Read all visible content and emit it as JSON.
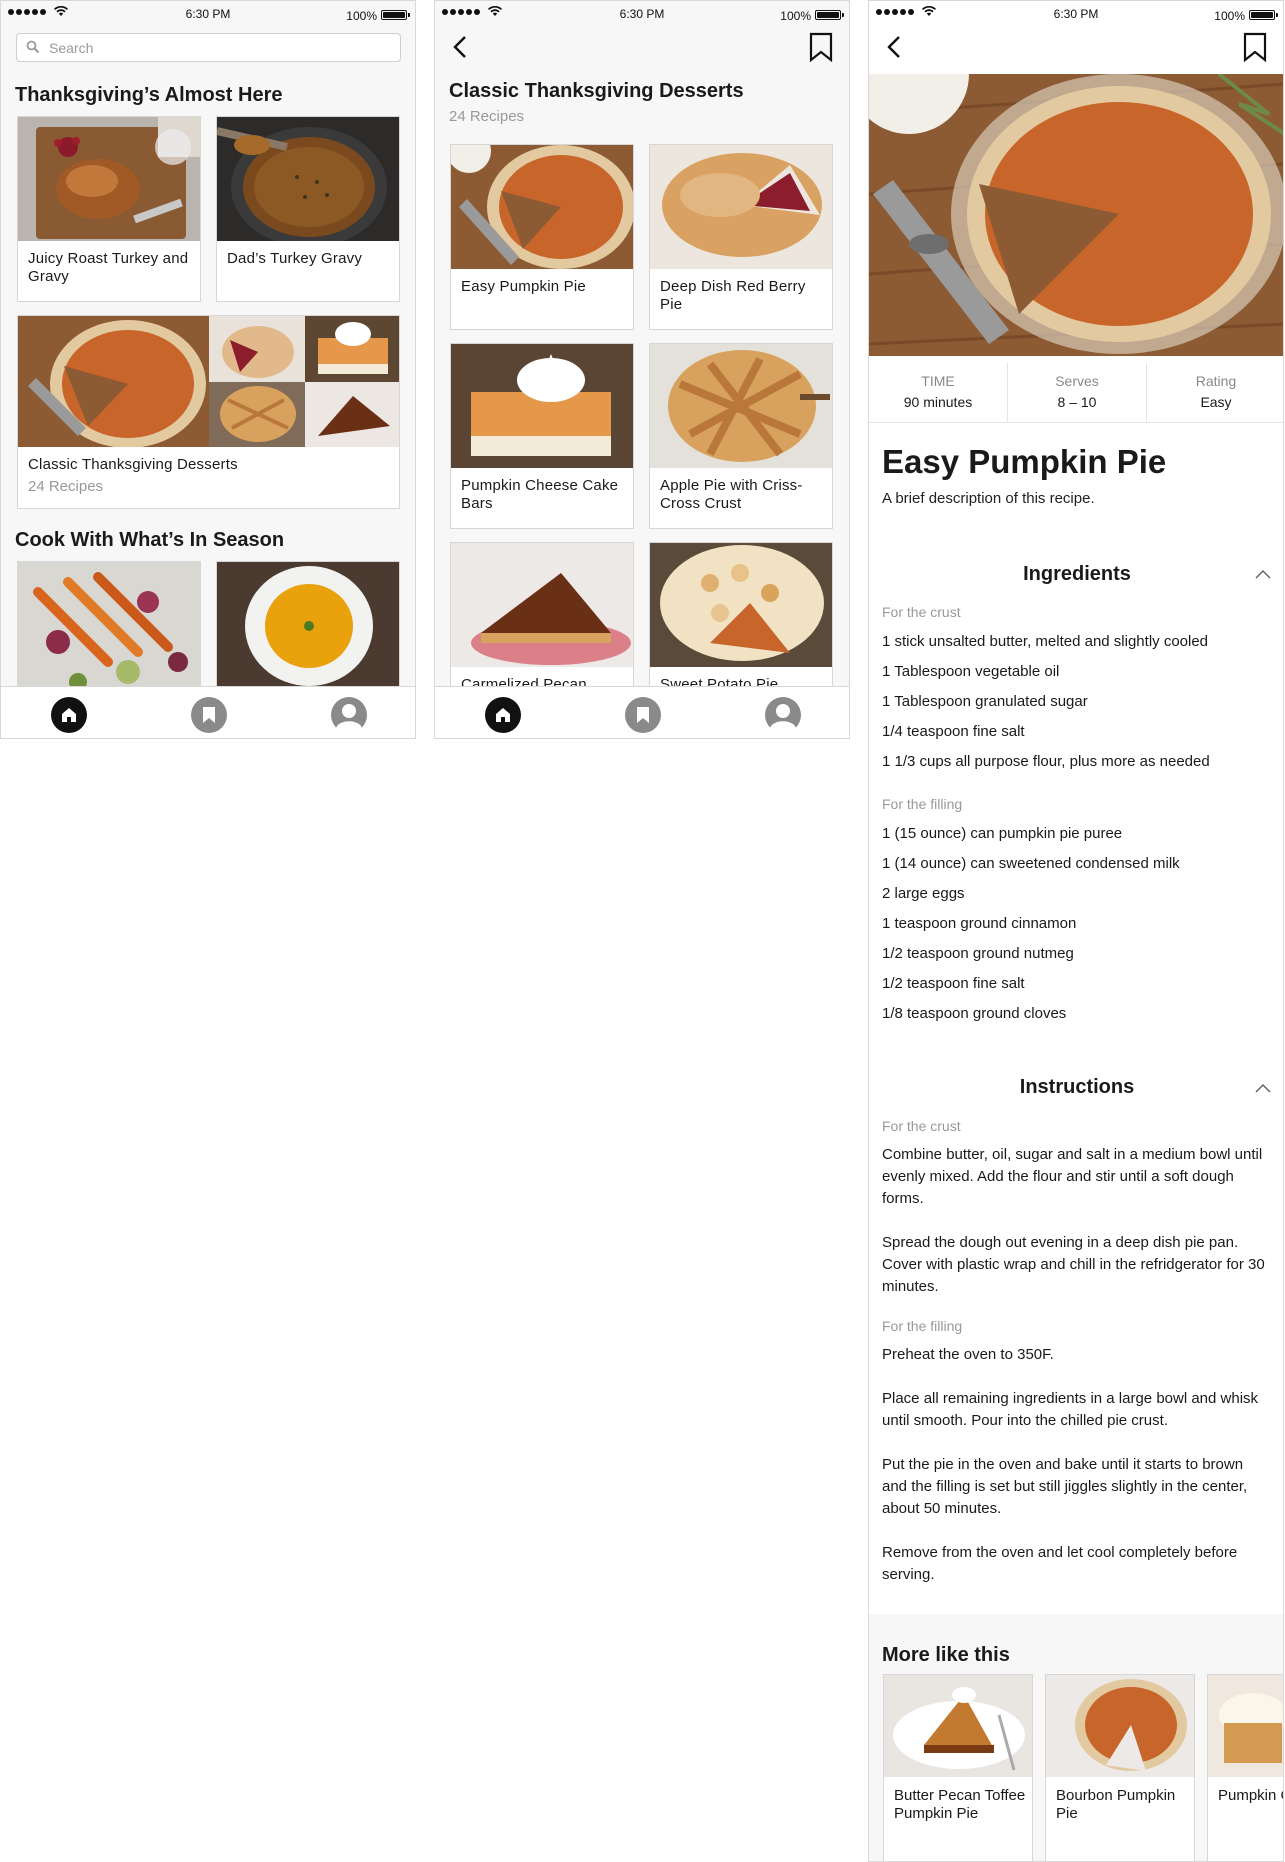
{
  "status_bar": {
    "time": "6:30 PM",
    "battery": "100%"
  },
  "home": {
    "search_placeholder": "Search",
    "section1_title": "Thanksgiving’s Almost Here",
    "cards": [
      {
        "label": "Juicy Roast Turkey and Gravy"
      },
      {
        "label": "Dad’s Turkey Gravy"
      }
    ],
    "collection": {
      "label": "Classic Thanksgiving Desserts",
      "count": "24 Recipes"
    },
    "section2_title": "Cook With What’s In Season"
  },
  "collection": {
    "title": "Classic Thanksgiving Desserts",
    "count": "24 Recipes",
    "recipes": [
      {
        "label": "Easy Pumpkin Pie"
      },
      {
        "label": "Deep Dish Red Berry Pie"
      },
      {
        "label": "Pumpkin Cheese Cake Bars"
      },
      {
        "label": "Apple Pie with Criss-Cross Crust"
      },
      {
        "label": "Carmelized Pecan"
      },
      {
        "label": "Sweet Potato Pie"
      }
    ]
  },
  "recipe": {
    "facts": [
      {
        "key": "TIME",
        "value": "90 minutes"
      },
      {
        "key": "Serves",
        "value": "8 – 10"
      },
      {
        "key": "Rating",
        "value": "Easy"
      }
    ],
    "title": "Easy Pumpkin Pie",
    "description": "A brief description of this recipe.",
    "ingredients_title": "Ingredients",
    "ingredients": {
      "crust_label": "For the crust",
      "crust": [
        "1 stick unsalted butter, melted and slightly cooled",
        "1 Tablespoon vegetable oil",
        "1 Tablespoon granulated sugar",
        "1/4 teaspoon fine salt",
        "1 1/3 cups all purpose flour, plus more as needed"
      ],
      "filling_label": "For the filling",
      "filling": [
        "1 (15 ounce) can pumpkin pie puree",
        "1 (14 ounce) can sweetened condensed milk",
        "2 large eggs",
        "1 teaspoon ground cinnamon",
        "1/2 teaspoon ground nutmeg",
        "1/2 teaspoon fine salt",
        "1/8 teaspoon ground cloves"
      ]
    },
    "instructions_title": "Instructions",
    "instructions": {
      "crust_label": "For the crust",
      "crust": [
        "Combine butter, oil, sugar and salt in a medium bowl until evenly mixed. Add the flour and stir until a soft dough forms.",
        "Spread the dough out evening in a deep dish pie pan. Cover with plastic wrap and chill in the refridgerator for 30 minutes."
      ],
      "filling_label": "For the filling",
      "filling": [
        "Preheat the oven to 350F.",
        "Place all remaining ingredients in a large bowl and whisk until smooth. Pour into the chilled pie crust.",
        "Put the pie in the oven and bake until it starts to brown and the filling is set but still jiggles slightly in the center, about 50 minutes.",
        "Remove from the oven and let cool completely before serving."
      ]
    },
    "more_title": "More like this",
    "more": [
      {
        "label": "Butter Pecan Toffee Pumpkin Pie"
      },
      {
        "label": "Bourbon Pumpkin Pie"
      },
      {
        "label": "Pumpkin Cupcakes"
      }
    ]
  }
}
